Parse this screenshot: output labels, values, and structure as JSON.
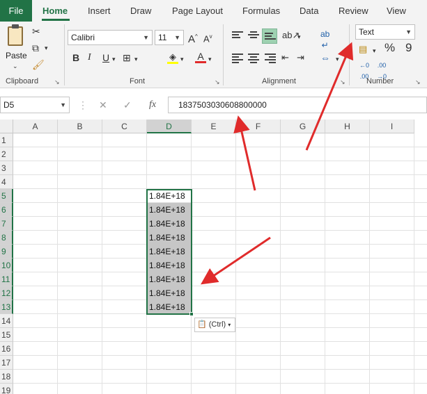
{
  "ribbon_tabs": [
    "File",
    "Home",
    "Insert",
    "Draw",
    "Page Layout",
    "Formulas",
    "Data",
    "Review",
    "View"
  ],
  "active_tab": "Home",
  "clipboard": {
    "paste_label": "Paste",
    "group_label": "Clipboard"
  },
  "font": {
    "name": "Calibri",
    "size": "11",
    "group_label": "Font",
    "bold": "B",
    "italic": "I",
    "underline": "U",
    "grow": "A",
    "shrink": "A",
    "font_color": "A"
  },
  "alignment": {
    "group_label": "Alignment"
  },
  "number": {
    "format": "Text",
    "group_label": "Number",
    "percent": "%",
    "comma": "9",
    "inc_decimal": "←0 .00",
    "dec_decimal": ".00 →0"
  },
  "formula_bar": {
    "name_box": "D5",
    "cancel": "✕",
    "enter": "✓",
    "fx": "fx",
    "value": "1837503030608800000"
  },
  "columns": [
    "A",
    "B",
    "C",
    "D",
    "E",
    "F",
    "G",
    "H",
    "I"
  ],
  "selected_column": "D",
  "rows": [
    "1",
    "2",
    "3",
    "4",
    "5",
    "6",
    "7",
    "8",
    "9",
    "10",
    "11",
    "12",
    "13",
    "14",
    "15",
    "16",
    "17",
    "18",
    "19"
  ],
  "cells": [
    {
      "ref": "D5",
      "value": "1.84E+18",
      "row_index": 4,
      "highlighted": false
    },
    {
      "ref": "D6",
      "value": "1.84E+18",
      "row_index": 5,
      "highlighted": true
    },
    {
      "ref": "D7",
      "value": "1.84E+18",
      "row_index": 6,
      "highlighted": true
    },
    {
      "ref": "D8",
      "value": "1.84E+18",
      "row_index": 7,
      "highlighted": true
    },
    {
      "ref": "D9",
      "value": "1.84E+18",
      "row_index": 8,
      "highlighted": true
    },
    {
      "ref": "D10",
      "value": "1.84E+18",
      "row_index": 9,
      "highlighted": true
    },
    {
      "ref": "D11",
      "value": "1.84E+18",
      "row_index": 10,
      "highlighted": true
    },
    {
      "ref": "D12",
      "value": "1.84E+18",
      "row_index": 11,
      "highlighted": true
    },
    {
      "ref": "D13",
      "value": "1.84E+18",
      "row_index": 12,
      "highlighted": true
    }
  ],
  "paste_options": {
    "label": "(Ctrl)"
  },
  "colors": {
    "accent": "#217346",
    "selection_fill": "#c6c6c6",
    "annotation_arrow": "#e02b2b"
  }
}
